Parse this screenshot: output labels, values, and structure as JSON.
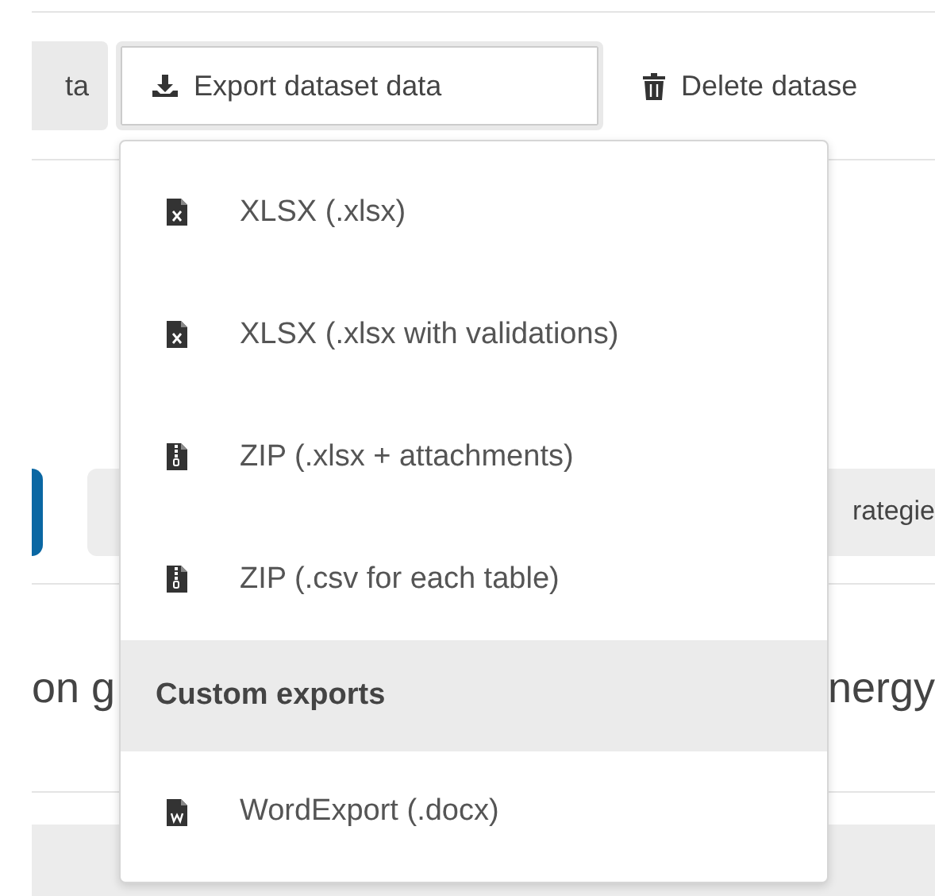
{
  "toolbar": {
    "buttons": [
      {
        "label": "ta",
        "kind": "plain",
        "selected": false
      },
      {
        "label": "Export dataset data",
        "kind": "download",
        "selected": true
      },
      {
        "label": "Delete datase",
        "kind": "delete",
        "selected": false
      }
    ]
  },
  "export_menu": {
    "sections": [
      {
        "items": [
          {
            "label": "XLSX (.xlsx)",
            "kind": "xlsx"
          },
          {
            "label": "XLSX (.xlsx with validations)",
            "kind": "xlsx"
          },
          {
            "label": "ZIP (.xlsx + attachments)",
            "kind": "zip"
          },
          {
            "label": "ZIP (.csv for each table)",
            "kind": "zip"
          }
        ]
      },
      {
        "header": "Custom exports",
        "items": [
          {
            "label": "WordExport (.docx)",
            "kind": "docx"
          }
        ]
      }
    ]
  },
  "tabs_row": {
    "tab_label": "rategie"
  },
  "content_row": {
    "left_text": "on g",
    "right_text": "nergy"
  }
}
